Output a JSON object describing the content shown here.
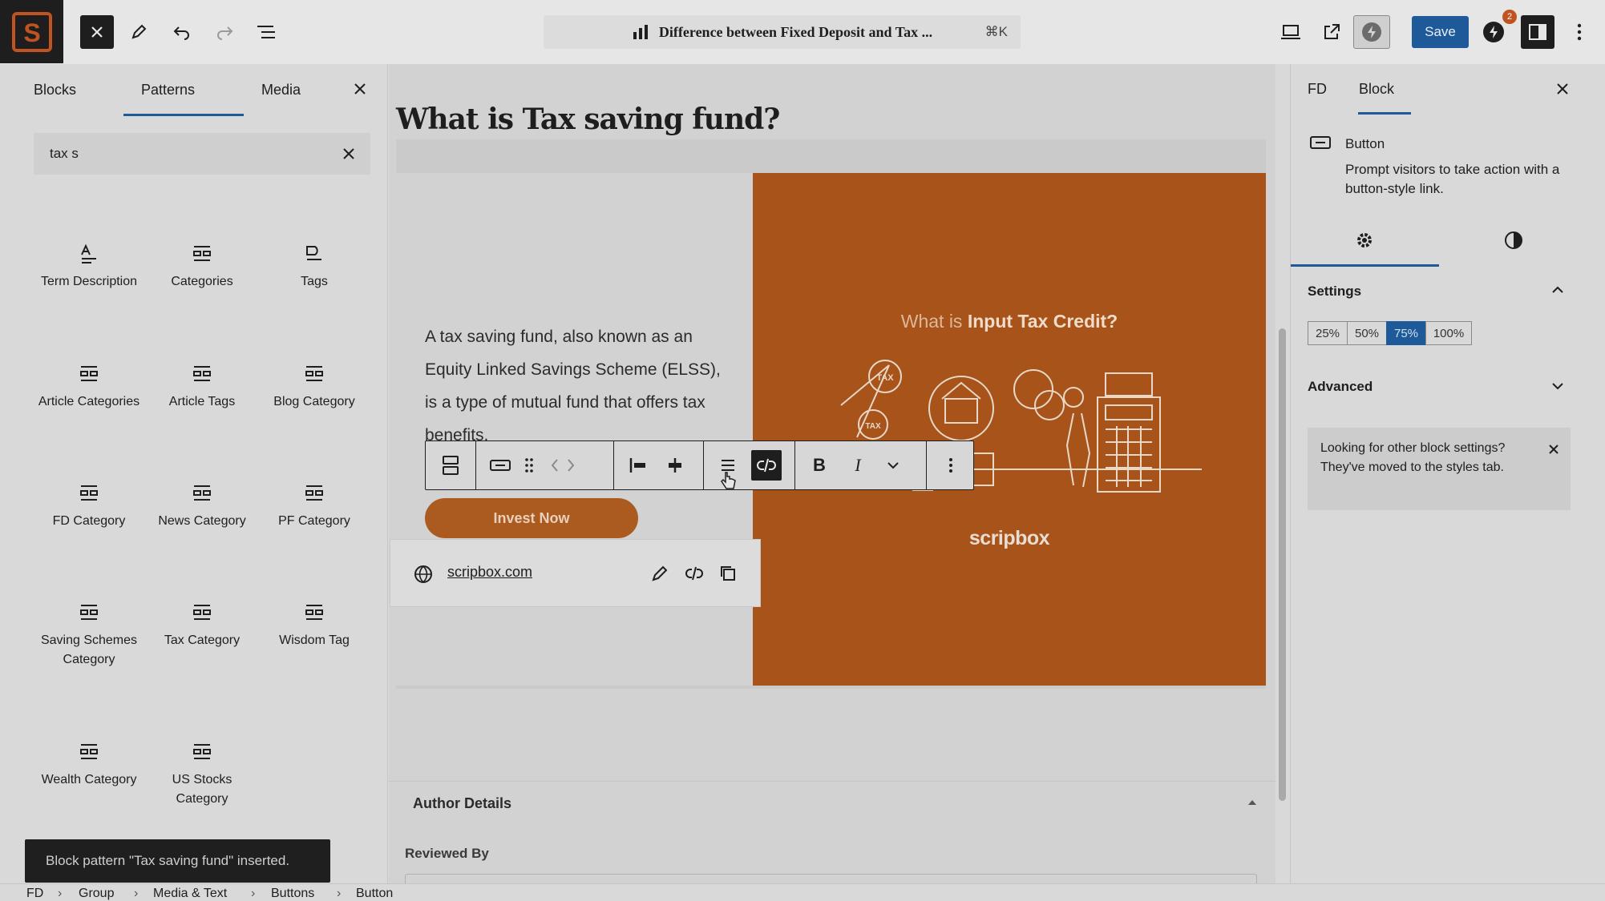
{
  "toolbar": {
    "doc_title": "Difference between Fixed Deposit and Tax ...",
    "shortcut": "⌘K",
    "save_label": "Save",
    "notification_count": "2"
  },
  "inserter": {
    "tabs": [
      "Blocks",
      "Patterns",
      "Media"
    ],
    "active_tab": "Patterns",
    "search_value": "tax s",
    "categories": [
      {
        "label": "Term Description",
        "icon": "term-description-icon"
      },
      {
        "label": "Categories",
        "icon": "categories-icon"
      },
      {
        "label": "Tags",
        "icon": "tags-icon"
      },
      {
        "label": "Article Categories",
        "icon": "categories-icon"
      },
      {
        "label": "Article Tags",
        "icon": "categories-icon"
      },
      {
        "label": "Blog Category",
        "icon": "categories-icon"
      },
      {
        "label": "FD Category",
        "icon": "categories-icon"
      },
      {
        "label": "News Category",
        "icon": "categories-icon"
      },
      {
        "label": "PF Category",
        "icon": "categories-icon"
      },
      {
        "label": "Saving Schemes Category",
        "icon": "categories-icon"
      },
      {
        "label": "Tax Category",
        "icon": "categories-icon"
      },
      {
        "label": "Wisdom Tag",
        "icon": "categories-icon"
      },
      {
        "label": "Wealth Category",
        "icon": "categories-icon"
      },
      {
        "label": "US Stocks Category",
        "icon": "categories-icon"
      }
    ]
  },
  "canvas": {
    "heading": "What is Tax saving fund?",
    "paragraph": "A tax saving fund, also known as an Equity Linked Savings Scheme (ELSS), is a type of mutual fund that offers tax benefits.",
    "button_label": "Invest Now",
    "link_url": "scripbox.com",
    "image_title_prefix": "What is ",
    "image_title_bold": "Input Tax Credit?",
    "image_brand": "scripbox",
    "author_section": "Author Details",
    "reviewed_by": "Reviewed By"
  },
  "sidebar": {
    "tabs": [
      "FD",
      "Block"
    ],
    "active_tab": "Block",
    "block_name": "Button",
    "block_description": "Prompt visitors to take action with a button-style link.",
    "settings_title": "Settings",
    "width_options": [
      "25%",
      "50%",
      "75%",
      "100%"
    ],
    "selected_width": "75%",
    "advanced_title": "Advanced",
    "notice": "Looking for other block settings? They've moved to the styles tab."
  },
  "snackbar": "Block pattern \"Tax saving fund\" inserted.",
  "breadcrumb": [
    "FD",
    "Group",
    "Media & Text",
    "Buttons",
    "Button"
  ],
  "colors": {
    "accent": "#1e5a99",
    "button_orange": "#ab5b1f",
    "image_orange": "#a8531a"
  }
}
